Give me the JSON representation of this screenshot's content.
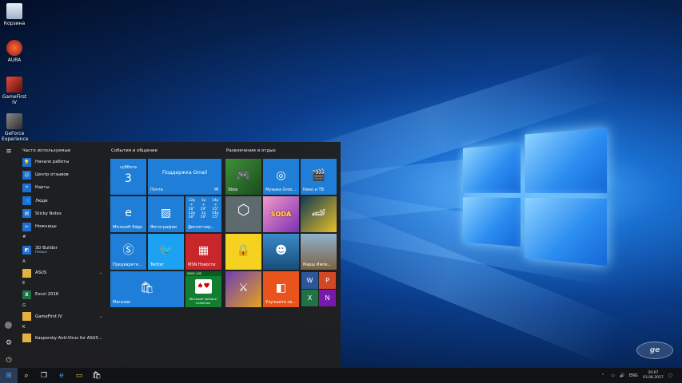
{
  "desktop": {
    "icons": [
      {
        "label": "Корзина",
        "icon": "recycle-bin-icon",
        "color": "#b8c7d9"
      },
      {
        "label": "AURA",
        "icon": "aura-icon",
        "color": "#c0392b"
      },
      {
        "label": "GameFirst IV",
        "icon": "gamefirst-icon",
        "color": "#b03a2e"
      },
      {
        "label": "GeForce Experience",
        "icon": "geforce-icon",
        "color": "#6a6a6a"
      }
    ]
  },
  "start_menu": {
    "most_used_title": "Часто используемые",
    "most_used": [
      {
        "label": "Начало работы",
        "icon": "lightbulb-icon"
      },
      {
        "label": "Центр отзывов",
        "icon": "feedback-icon"
      },
      {
        "label": "Карты",
        "icon": "maps-icon"
      },
      {
        "label": "Люди",
        "icon": "people-icon"
      },
      {
        "label": "Sticky Notes",
        "icon": "sticky-notes-icon"
      },
      {
        "label": "Ножницы",
        "icon": "scissors-icon"
      }
    ],
    "sections": [
      {
        "letter": "#",
        "items": [
          {
            "label": "3D Builder",
            "sub": "Новые",
            "icon": "3d-builder-icon",
            "chevron": false
          }
        ]
      },
      {
        "letter": "A",
        "items": [
          {
            "label": "ASUS",
            "sub": "",
            "icon": "folder-icon",
            "chevron": true
          }
        ]
      },
      {
        "letter": "E",
        "items": [
          {
            "label": "Excel 2016",
            "sub": "",
            "icon": "excel-icon",
            "chevron": false
          }
        ]
      },
      {
        "letter": "G",
        "items": [
          {
            "label": "GameFirst IV",
            "sub": "",
            "icon": "folder-icon",
            "chevron": true
          }
        ]
      },
      {
        "letter": "K",
        "items": [
          {
            "label": "Kaspersky Anti-Virus for ASUS",
            "sub": "",
            "icon": "folder-icon",
            "chevron": true
          }
        ]
      }
    ],
    "group_left_title": "События и общение",
    "group_right_title": "Развлечения и отдых",
    "calendar": {
      "day": "суббота",
      "date": "3"
    },
    "mail": {
      "title": "Поддержка Gmail",
      "label": "Почта"
    },
    "edge_label": "Microsoft Edge",
    "photos_label": "Фотографии",
    "weather": {
      "hours": [
        "12p",
        "1p",
        "14p"
      ],
      "temps": [
        "18°",
        "19°",
        "15°"
      ],
      "hours2": [
        "12p",
        "1p",
        "14p"
      ],
      "temps2": [
        "18°",
        "19°",
        "15°"
      ],
      "label": "Диспетчер..."
    },
    "skype_label": "Предварите...",
    "twitter_label": "Twitter",
    "msn_label": "MSN Новости",
    "store_label": "Магазин",
    "solitaire": {
      "badge": "XBOX LIVE",
      "label": "Microsoft Solitaire Collection"
    },
    "xbox_label": "Xbox",
    "groove_label": "Музыка Groo...",
    "movies_label": "Кино и ТВ",
    "marchofempires_label": "Марш Импе...",
    "office_label": "Улучшите св...",
    "candy_text": "SODA"
  },
  "taskbar": {
    "tray_lang": "ENG",
    "time": "20:07",
    "date": "03.06.2017"
  },
  "watermark": "ge"
}
